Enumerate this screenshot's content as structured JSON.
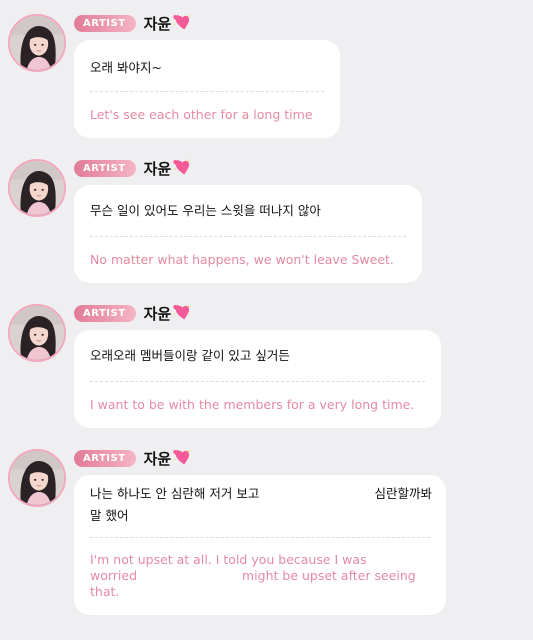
{
  "messages": [
    {
      "badge": "ARTIST",
      "name": "자윤",
      "emoji_icon": "sparkling-heart-icon",
      "text": "오래 봐야지~",
      "translation": "Let's see each other for a long time"
    },
    {
      "badge": "ARTIST",
      "name": "자윤",
      "emoji_icon": "sparkling-heart-icon",
      "text": "무슨 일이 있어도 우리는 스윗을 떠나지 않아",
      "translation": "No matter what happens, we won't leave Sweet."
    },
    {
      "badge": "ARTIST",
      "name": "자윤",
      "emoji_icon": "sparkling-heart-icon",
      "text": "오래오래 멤버들이랑 같이 있고 싶거든",
      "translation": "I want to be with the members for a very long time."
    },
    {
      "badge": "ARTIST",
      "name": "자윤",
      "emoji_icon": "sparkling-heart-icon",
      "text_line1_left": "나는 하나도 안 심란해 저거 보고",
      "text_line1_right": "심란할까봐",
      "text_line2": "말 했어",
      "translation_line1": "I'm not upset at all. I told you because I was",
      "translation_line2_left": "worried",
      "translation_line2_right": "might be upset after seeing",
      "translation_line3": "that."
    }
  ],
  "colors": {
    "background": "#efeff2",
    "bubble": "#ffffff",
    "badge_start": "#e27b97",
    "badge_end": "#f4b5c5",
    "translation": "#e58aa3",
    "avatar_ring": "#f2a7bf"
  }
}
